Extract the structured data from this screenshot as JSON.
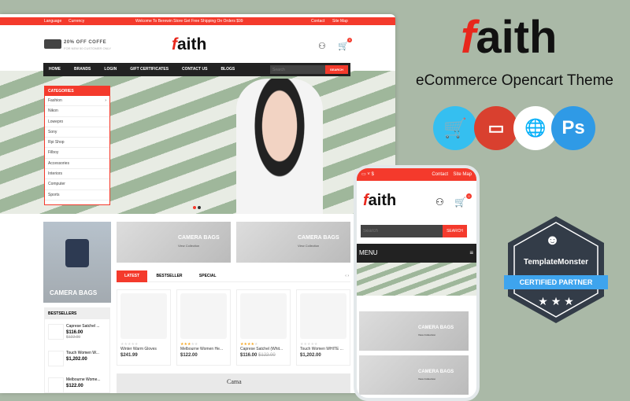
{
  "colors": {
    "brand_red": "#f43a2c",
    "background": "#aab9a7",
    "dark": "#222222"
  },
  "desktop": {
    "topbar": {
      "language": "Language",
      "currency": "Currency",
      "welcome": "Welcome To Berewin Store Get Free Shipping On Orders $99",
      "contact": "Contact",
      "sitemap": "Site Map"
    },
    "promo": {
      "title": "20% OFF COFFE",
      "subtitle": "FOR NEW 50 CUSTOMER ONLY"
    },
    "logo": {
      "first": "f",
      "rest": "aith"
    },
    "cart_count": "0",
    "nav": [
      "HOME",
      "BRANDS",
      "LOGIN",
      "GIFT CERTIFICATES",
      "CONTACT US",
      "BLOGS"
    ],
    "search": {
      "placeholder": "Search",
      "button": "SEARCH"
    },
    "categories": {
      "title": "CATEGORIES",
      "items": [
        "Fashion",
        "Nikon",
        "Lowepro",
        "Sony",
        "Rpi Shop",
        "Filboy",
        "Accessories",
        "Interiors",
        "Computer",
        "Sports"
      ]
    },
    "banners": {
      "left": "CAMERA BAGS",
      "b1": "CAMERA BAGS",
      "b2": "CAMERA BAGS",
      "link": "View Collection"
    },
    "tabs": [
      "LATEST",
      "BESTSELLER",
      "SPECIAL"
    ],
    "products": [
      {
        "name": "Winter Warm Gloves",
        "price": "$241.99",
        "old": "",
        "rating": 0
      },
      {
        "name": "Melbourne Women He...",
        "price": "$122.00",
        "old": "",
        "rating": 3
      },
      {
        "name": "Caprese Satchel (Whit...",
        "price": "$116.00",
        "old": "$122.00",
        "rating": 4
      },
      {
        "name": "Touch Women WHITE ...",
        "price": "$1,202.00",
        "old": "",
        "rating": 0
      }
    ],
    "bestsellers": {
      "title": "BESTSELLERS",
      "items": [
        {
          "name": "Caprese Satchel ...",
          "price": "$116.00",
          "old": "$122.00"
        },
        {
          "name": "Touch Women W...",
          "price": "$1,202.00"
        },
        {
          "name": "Melbourne Wome...",
          "price": "$122.00"
        }
      ]
    },
    "bottom_banner": "Cama"
  },
  "mobile": {
    "currency": "$",
    "contact": "Contact",
    "sitemap": "Site Map",
    "search_placeholder": "Search",
    "search_button": "SEARCH",
    "menu": "MENU",
    "banner1": "CAMERA BAGS",
    "banner2": "CAMERA BAGS",
    "link": "View Collection",
    "cart_count": "0"
  },
  "promo_side": {
    "logo_first": "f",
    "logo_rest": "aith",
    "subtitle": "eCommerce Opencart Theme",
    "icons": [
      "opencart-icon",
      "responsive-icon",
      "multilanguage-icon",
      "photoshop-icon"
    ],
    "ps": "Ps"
  },
  "badge": {
    "brand": "TemplateMonster",
    "label": "CERTIFIED PARTNER",
    "stars": "★ ★ ★"
  }
}
